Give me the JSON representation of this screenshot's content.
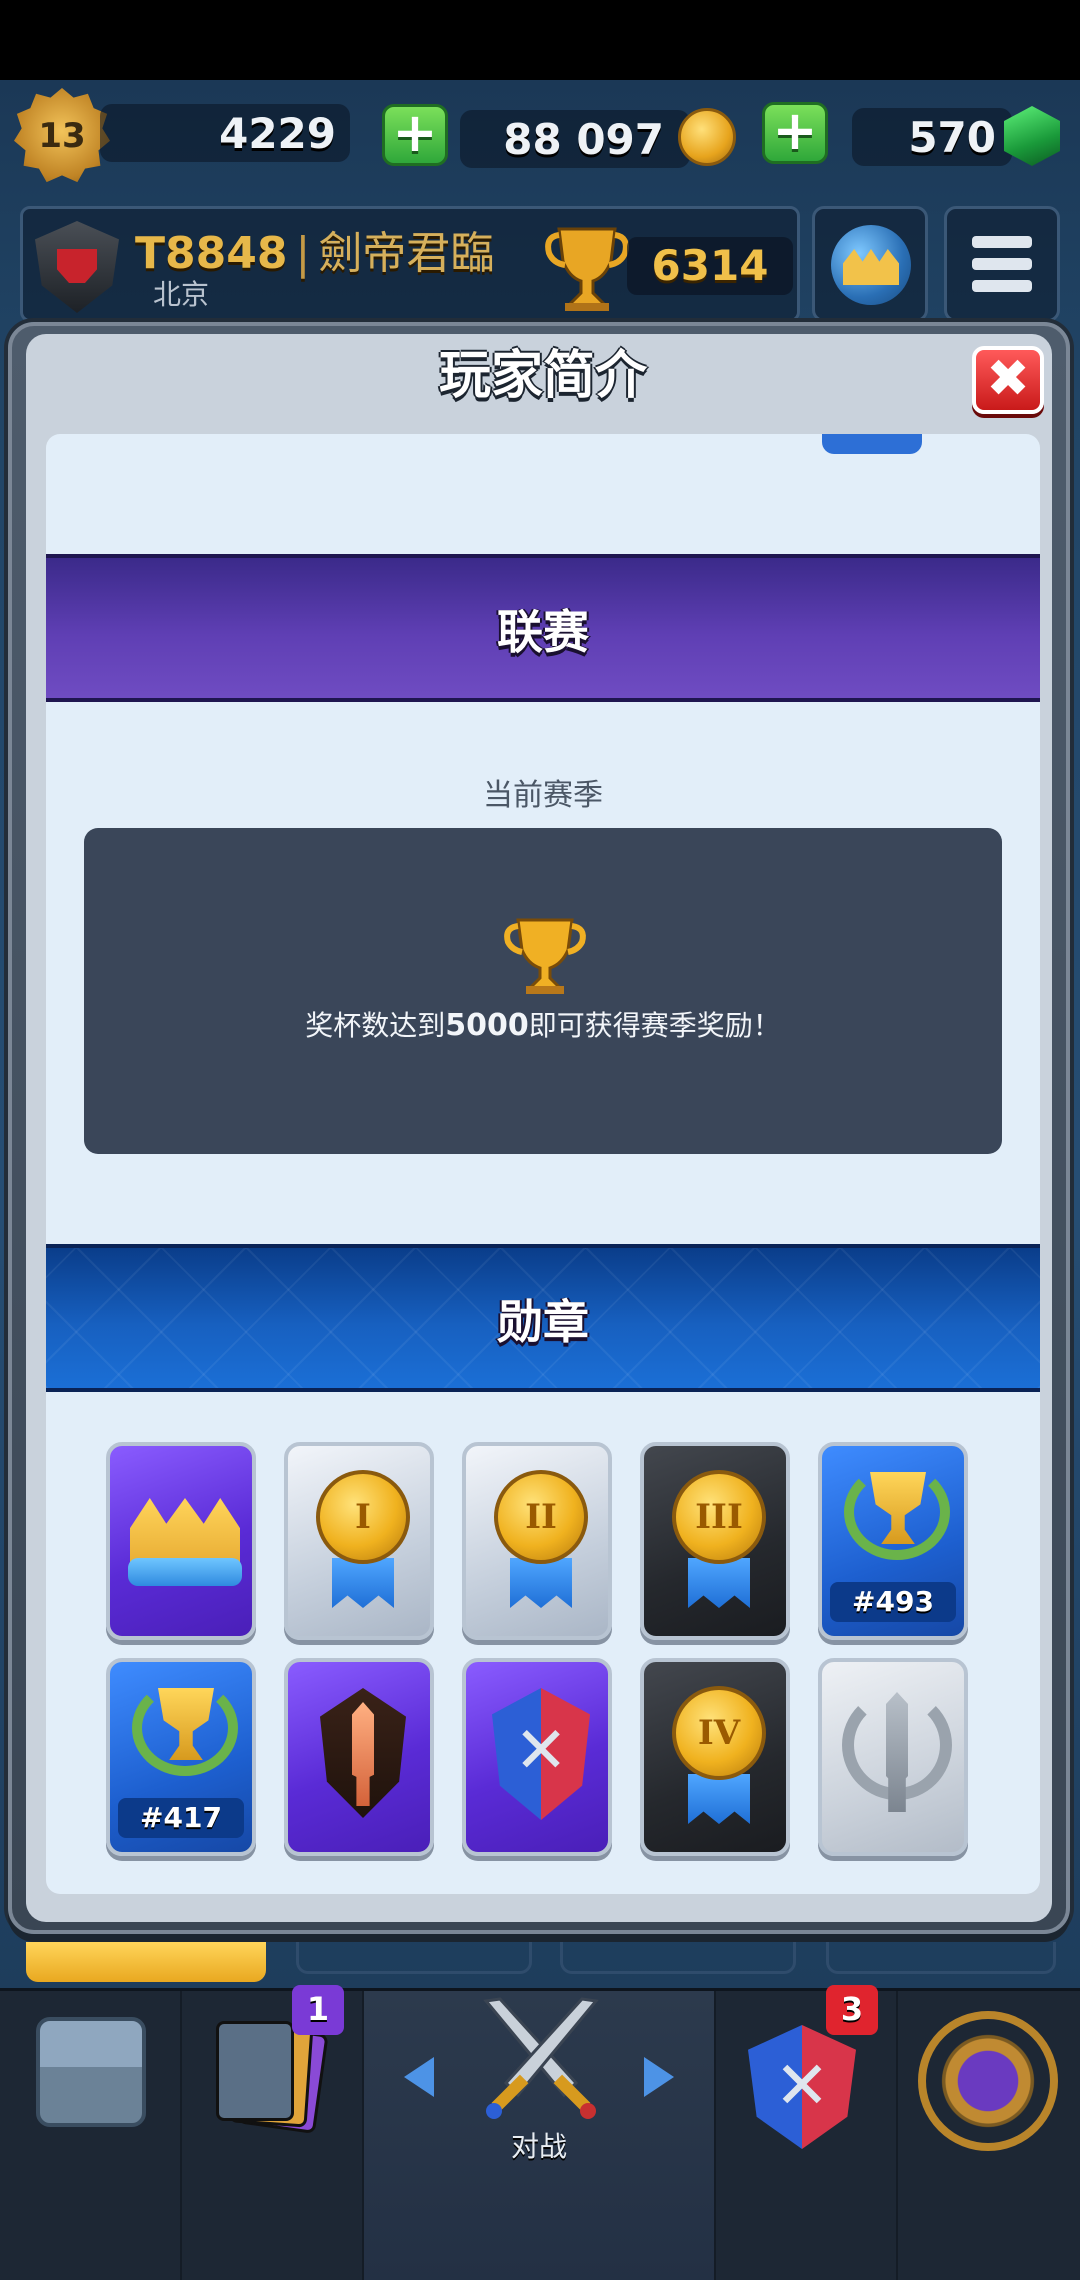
{
  "topbar": {
    "level": "13",
    "gold_display": "4229",
    "coins": "88 097",
    "gems": "570",
    "add_label": "+"
  },
  "profile": {
    "player_name": "T8848",
    "separator": "|",
    "clan_name": "劍帝君臨",
    "location": "北京",
    "trophies": "6314"
  },
  "modal": {
    "title": "玩家简介",
    "close_label": "✖"
  },
  "league": {
    "header": "联赛",
    "season_label": "当前赛季",
    "message_before": "奖杯数达到",
    "message_value": "5000",
    "message_after": "即可获得赛季奖励！"
  },
  "badges": {
    "header": "勋章",
    "items": [
      {
        "name": "crown",
        "style": "purple",
        "text": ""
      },
      {
        "name": "medal-1",
        "style": "silver",
        "text": "I"
      },
      {
        "name": "medal-2",
        "style": "silver",
        "text": "II"
      },
      {
        "name": "medal-3",
        "style": "dark",
        "text": "III"
      },
      {
        "name": "rank-493",
        "style": "blue",
        "text": "#493"
      },
      {
        "name": "rank-417",
        "style": "blue",
        "text": "#417"
      },
      {
        "name": "sword-shield",
        "style": "purple",
        "text": ""
      },
      {
        "name": "crossed-shield",
        "style": "purple",
        "text": ""
      },
      {
        "name": "medal-4",
        "style": "dark",
        "text": "IV"
      },
      {
        "name": "gray-laurel",
        "style": "lightgray",
        "text": ""
      }
    ]
  },
  "bottom_nav": {
    "cards_badge": "1",
    "clan_badge": "3",
    "battle_label": "对战"
  },
  "colors": {
    "league_purple": "#5f3fb4",
    "badges_blue": "#1760c0",
    "close_red": "#c91a1a",
    "gold_text": "#e7b84a"
  }
}
